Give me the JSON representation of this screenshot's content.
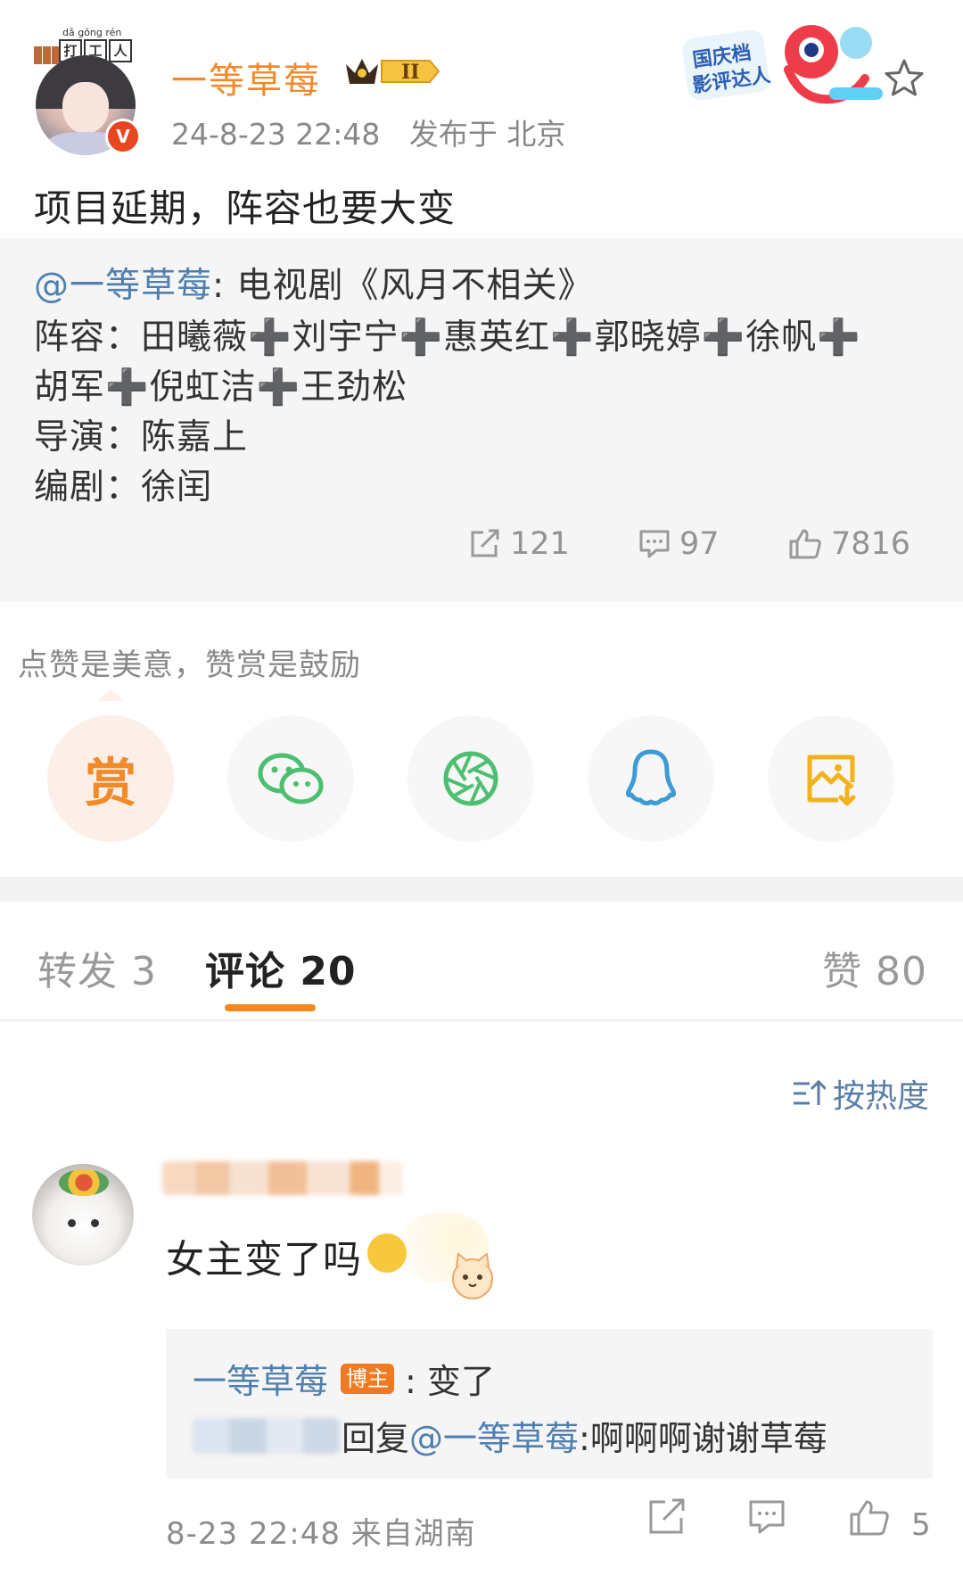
{
  "post": {
    "hat_pinyin": "dǎ gōng rén",
    "hat_chars": [
      "打",
      "工",
      "人"
    ],
    "author": "一等草莓",
    "level_badge": "II",
    "verified_badge": "V",
    "time": "24-8-23 22:48",
    "location": "发布于 北京",
    "sticker_text": "国庆档影评达人",
    "text": "项目延期，阵容也要大变"
  },
  "quoted": {
    "mention": "@一等草莓",
    "line1_rest": ": 电视剧《风月不相关》",
    "line2": "阵容：田曦薇➕刘宇宁➕惠英红➕郭晓婷➕徐帆➕",
    "line3": "胡军➕倪虹洁➕王劲松",
    "line4": "导演：陈嘉上",
    "line5": "编剧：徐闰",
    "reposts": "121",
    "comments": "97",
    "likes": "7816"
  },
  "reward": {
    "tip": "点赞是美意，赞赏是鼓励",
    "reward_char": "赏",
    "share_targets": [
      "wechat",
      "moments",
      "qq",
      "save-image"
    ]
  },
  "tabs": {
    "repost": "转发 3",
    "comment": "评论 20",
    "like": "赞 80"
  },
  "sort": {
    "label": "按热度"
  },
  "comment": {
    "text": "女主变了吗",
    "reply_author": "一等草莓",
    "reply_badge": "博主",
    "reply_text": ": 变了",
    "reply2_prefix": "回复",
    "reply2_mention": "@一等草莓",
    "reply2_text": ":啊啊啊谢谢草莓",
    "meta": "8-23 22:48  来自湖南",
    "like_count": "5"
  },
  "colors": {
    "accent_orange": "#f08a1f",
    "username_orange": "#f28a2b",
    "link_blue": "#4f7fae",
    "wechat_green": "#4cbf71",
    "qq_blue": "#3d9bd6",
    "save_yellow": "#f2b21c"
  }
}
